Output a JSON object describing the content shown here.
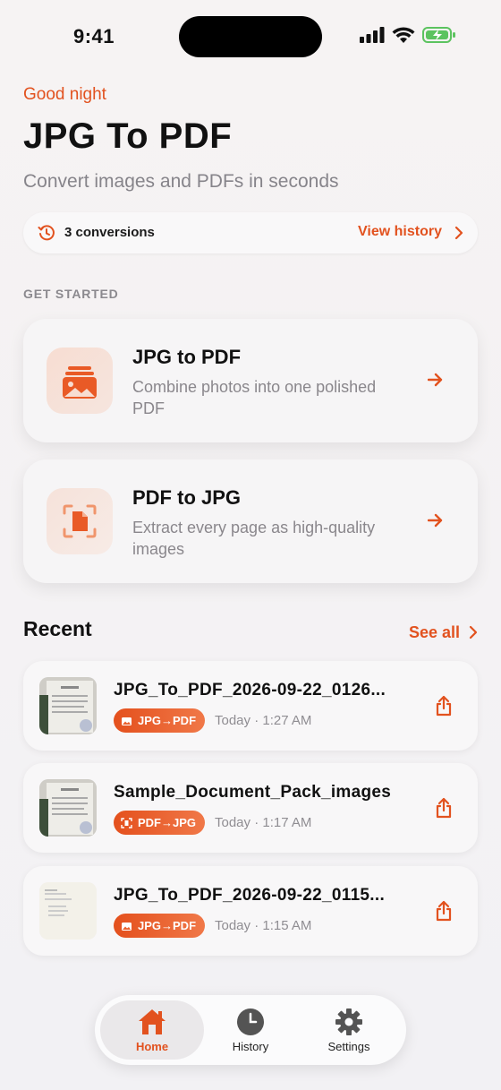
{
  "status_bar": {
    "time": "9:41"
  },
  "header": {
    "greeting": "Good night",
    "title": "JPG To PDF",
    "subtitle": "Convert images and PDFs in seconds"
  },
  "conversions_bar": {
    "icon": "history-icon",
    "count_label": "3 conversions",
    "view_history_label": "View history"
  },
  "section_label": "GET STARTED",
  "actions": [
    {
      "title": "JPG to PDF",
      "description": "Combine photos into one polished PDF",
      "icon": "photo-stack-icon"
    },
    {
      "title": "PDF to JPG",
      "description": "Extract every page as high-quality images",
      "icon": "scan-document-icon"
    }
  ],
  "recent": {
    "heading": "Recent",
    "see_all_label": "See all",
    "items": [
      {
        "name": "JPG_To_PDF_2026-09-22_0126...",
        "badge": "JPG→PDF",
        "time": "Today · 1:27 AM"
      },
      {
        "name": "Sample_Document_Pack_images",
        "badge": "PDF→JPG",
        "time": "Today · 1:17 AM"
      },
      {
        "name": "JPG_To_PDF_2026-09-22_0115...",
        "badge": "JPG→PDF",
        "time": "Today · 1:15 AM"
      }
    ]
  },
  "tabbar": {
    "tabs": [
      {
        "label": "Home",
        "icon": "home-icon",
        "active": true
      },
      {
        "label": "History",
        "icon": "clock-icon",
        "active": false
      },
      {
        "label": "Settings",
        "icon": "gear-icon",
        "active": false
      }
    ]
  },
  "colors": {
    "accent": "#e2521f",
    "muted_text": "#86848a",
    "background": "#f4f2f4"
  }
}
